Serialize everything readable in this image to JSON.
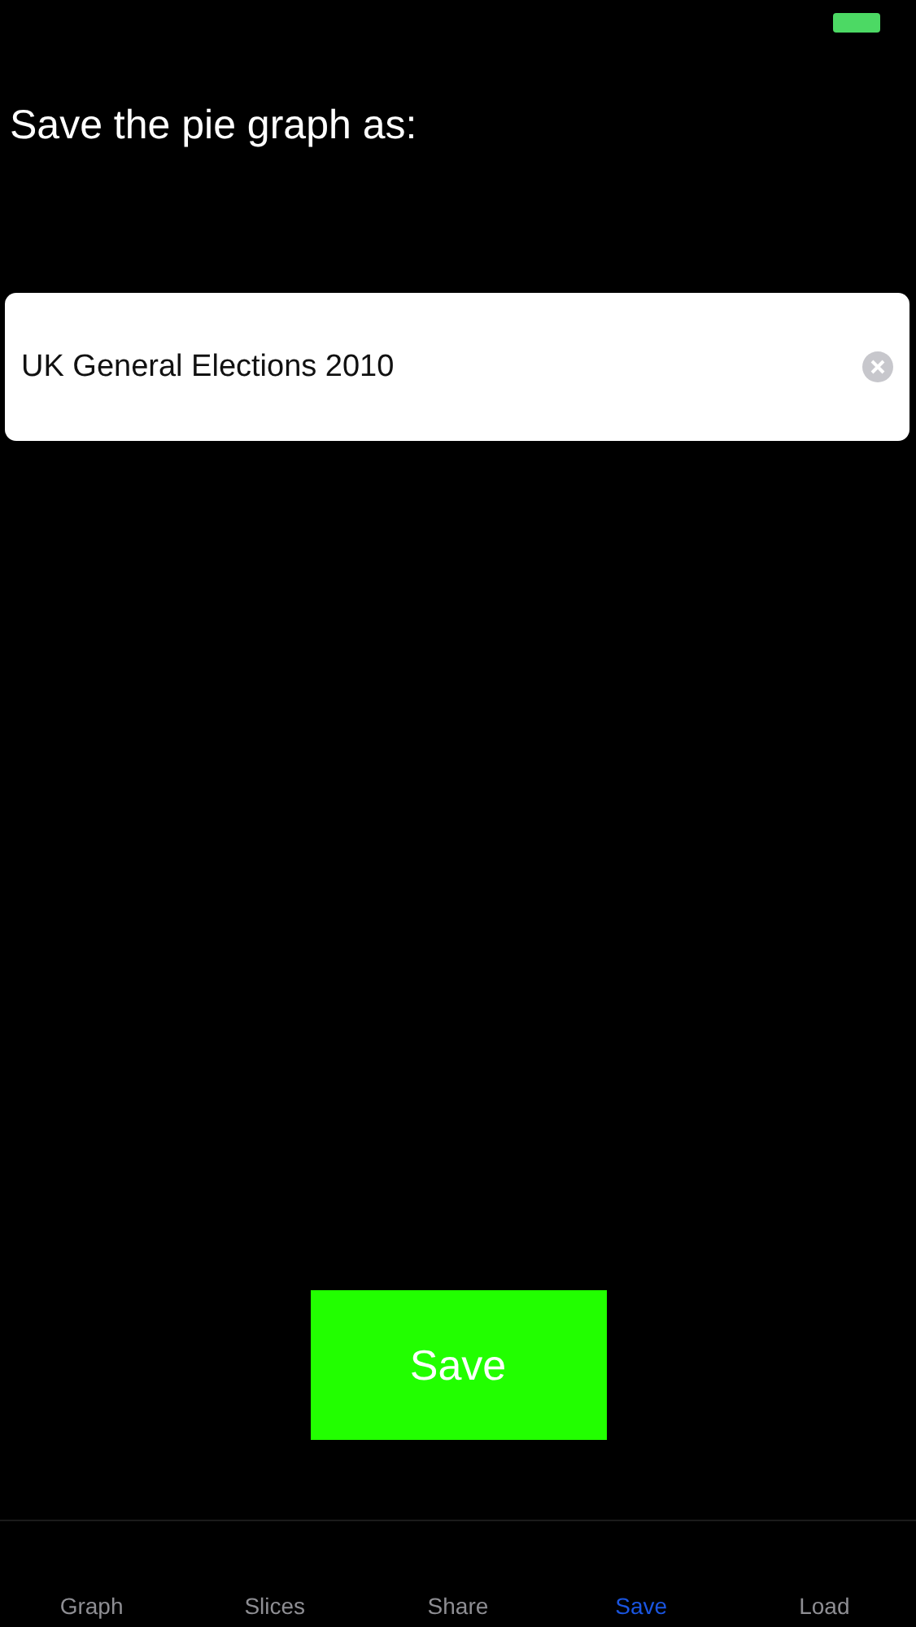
{
  "heading": "Save the pie graph as:",
  "name_field": {
    "value": "UK General Elections 2010"
  },
  "save_button": {
    "label": "Save"
  },
  "tabs": [
    {
      "label": "Graph",
      "selected": false
    },
    {
      "label": "Slices",
      "selected": false
    },
    {
      "label": "Share",
      "selected": false
    },
    {
      "label": "Save",
      "selected": true
    },
    {
      "label": "Load",
      "selected": false
    }
  ]
}
